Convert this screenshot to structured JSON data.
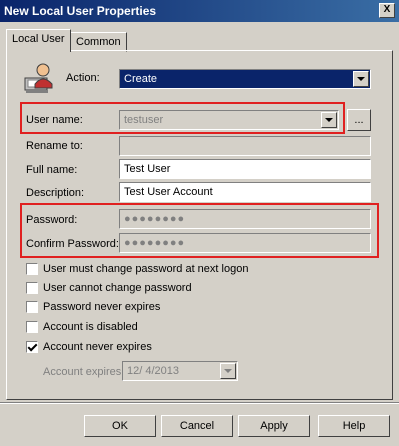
{
  "window": {
    "title": "New Local User Properties",
    "close_glyph": "X"
  },
  "tabs": [
    {
      "label": "Local User"
    },
    {
      "label": "Common"
    }
  ],
  "form": {
    "action_label": "Action:",
    "action_value": "Create",
    "username_label": "User name:",
    "username_value": "testuser",
    "browse_label": "...",
    "rename_label": "Rename to:",
    "rename_value": "",
    "fullname_label": "Full name:",
    "fullname_value": "Test User",
    "description_label": "Description:",
    "description_value": "Test User Account",
    "password_label": "Password:",
    "password_value": "●●●●●●●●",
    "confirm_label": "Confirm Password:",
    "confirm_value": "●●●●●●●●"
  },
  "options": [
    {
      "label": "User must change password at next logon",
      "checked": false
    },
    {
      "label": "User cannot change password",
      "checked": false
    },
    {
      "label": "Password never expires",
      "checked": false
    },
    {
      "label": "Account is disabled",
      "checked": false
    },
    {
      "label": "Account never expires",
      "checked": true
    }
  ],
  "expires": {
    "label": "Account expires:",
    "value": "12/  4/2013"
  },
  "buttons": {
    "ok": "OK",
    "cancel": "Cancel",
    "apply": "Apply",
    "help": "Help"
  },
  "colors": {
    "highlight": "#e02020",
    "selection": "#0a246a",
    "title_bar": "#0a246a"
  }
}
